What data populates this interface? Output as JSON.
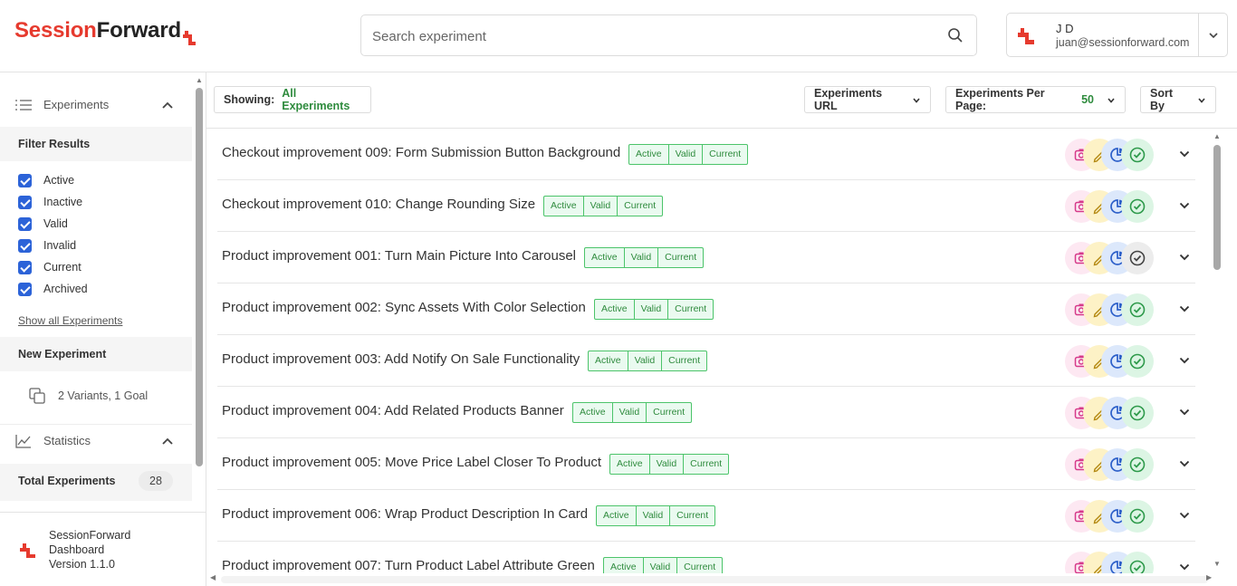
{
  "brand": {
    "name_part1": "Session",
    "name_part2": "Forward",
    "accent_color": "#e63a2e"
  },
  "search": {
    "placeholder": "Search experiment"
  },
  "user": {
    "initials": "J D",
    "email": "juan@sessionforward.com"
  },
  "sidebar": {
    "experiments_label": "Experiments",
    "filter_results_label": "Filter Results",
    "filters": [
      {
        "label": "Active",
        "checked": true
      },
      {
        "label": "Inactive",
        "checked": true
      },
      {
        "label": "Valid",
        "checked": true
      },
      {
        "label": "Invalid",
        "checked": true
      },
      {
        "label": "Current",
        "checked": true
      },
      {
        "label": "Archived",
        "checked": true
      }
    ],
    "show_all_label": "Show all Experiments",
    "new_experiment_label": "New Experiment",
    "variant_label": "2 Variants, 1 Goal",
    "statistics_label": "Statistics",
    "total_experiments_label": "Total Experiments",
    "total_experiments_value": "28",
    "footer": {
      "line1": "SessionForward",
      "line2": "Dashboard",
      "version": "Version 1.1.0"
    }
  },
  "toolbar": {
    "showing_label": "Showing:",
    "showing_value": "All Experiments",
    "experiments_url_label": "Experiments URL",
    "per_page_label": "Experiments Per Page:",
    "per_page_value": "50",
    "sort_by_label": "Sort By"
  },
  "experiments": [
    {
      "title": "Checkout improvement 009: Form Submission Button Background",
      "badges": [
        "Active",
        "Valid",
        "Current"
      ],
      "final_status": "green"
    },
    {
      "title": "Checkout improvement 010: Change Rounding Size",
      "badges": [
        "Active",
        "Valid",
        "Current"
      ],
      "final_status": "green"
    },
    {
      "title": "Product improvement 001: Turn Main Picture Into Carousel",
      "badges": [
        "Active",
        "Valid",
        "Current"
      ],
      "final_status": "gray"
    },
    {
      "title": "Product improvement 002: Sync Assets With Color Selection",
      "badges": [
        "Active",
        "Valid",
        "Current"
      ],
      "final_status": "green"
    },
    {
      "title": "Product improvement 003: Add Notify On Sale Functionality",
      "badges": [
        "Active",
        "Valid",
        "Current"
      ],
      "final_status": "green"
    },
    {
      "title": "Product improvement 004: Add Related Products Banner",
      "badges": [
        "Active",
        "Valid",
        "Current"
      ],
      "final_status": "green"
    },
    {
      "title": "Product improvement 005: Move Price Label Closer To Product",
      "badges": [
        "Active",
        "Valid",
        "Current"
      ],
      "final_status": "green"
    },
    {
      "title": "Product improvement 006: Wrap Product Description In Card",
      "badges": [
        "Active",
        "Valid",
        "Current"
      ],
      "final_status": "green"
    },
    {
      "title": "Product improvement 007: Turn Product Label Attribute Green",
      "badges": [
        "Active",
        "Valid",
        "Current"
      ],
      "final_status": "green"
    }
  ]
}
